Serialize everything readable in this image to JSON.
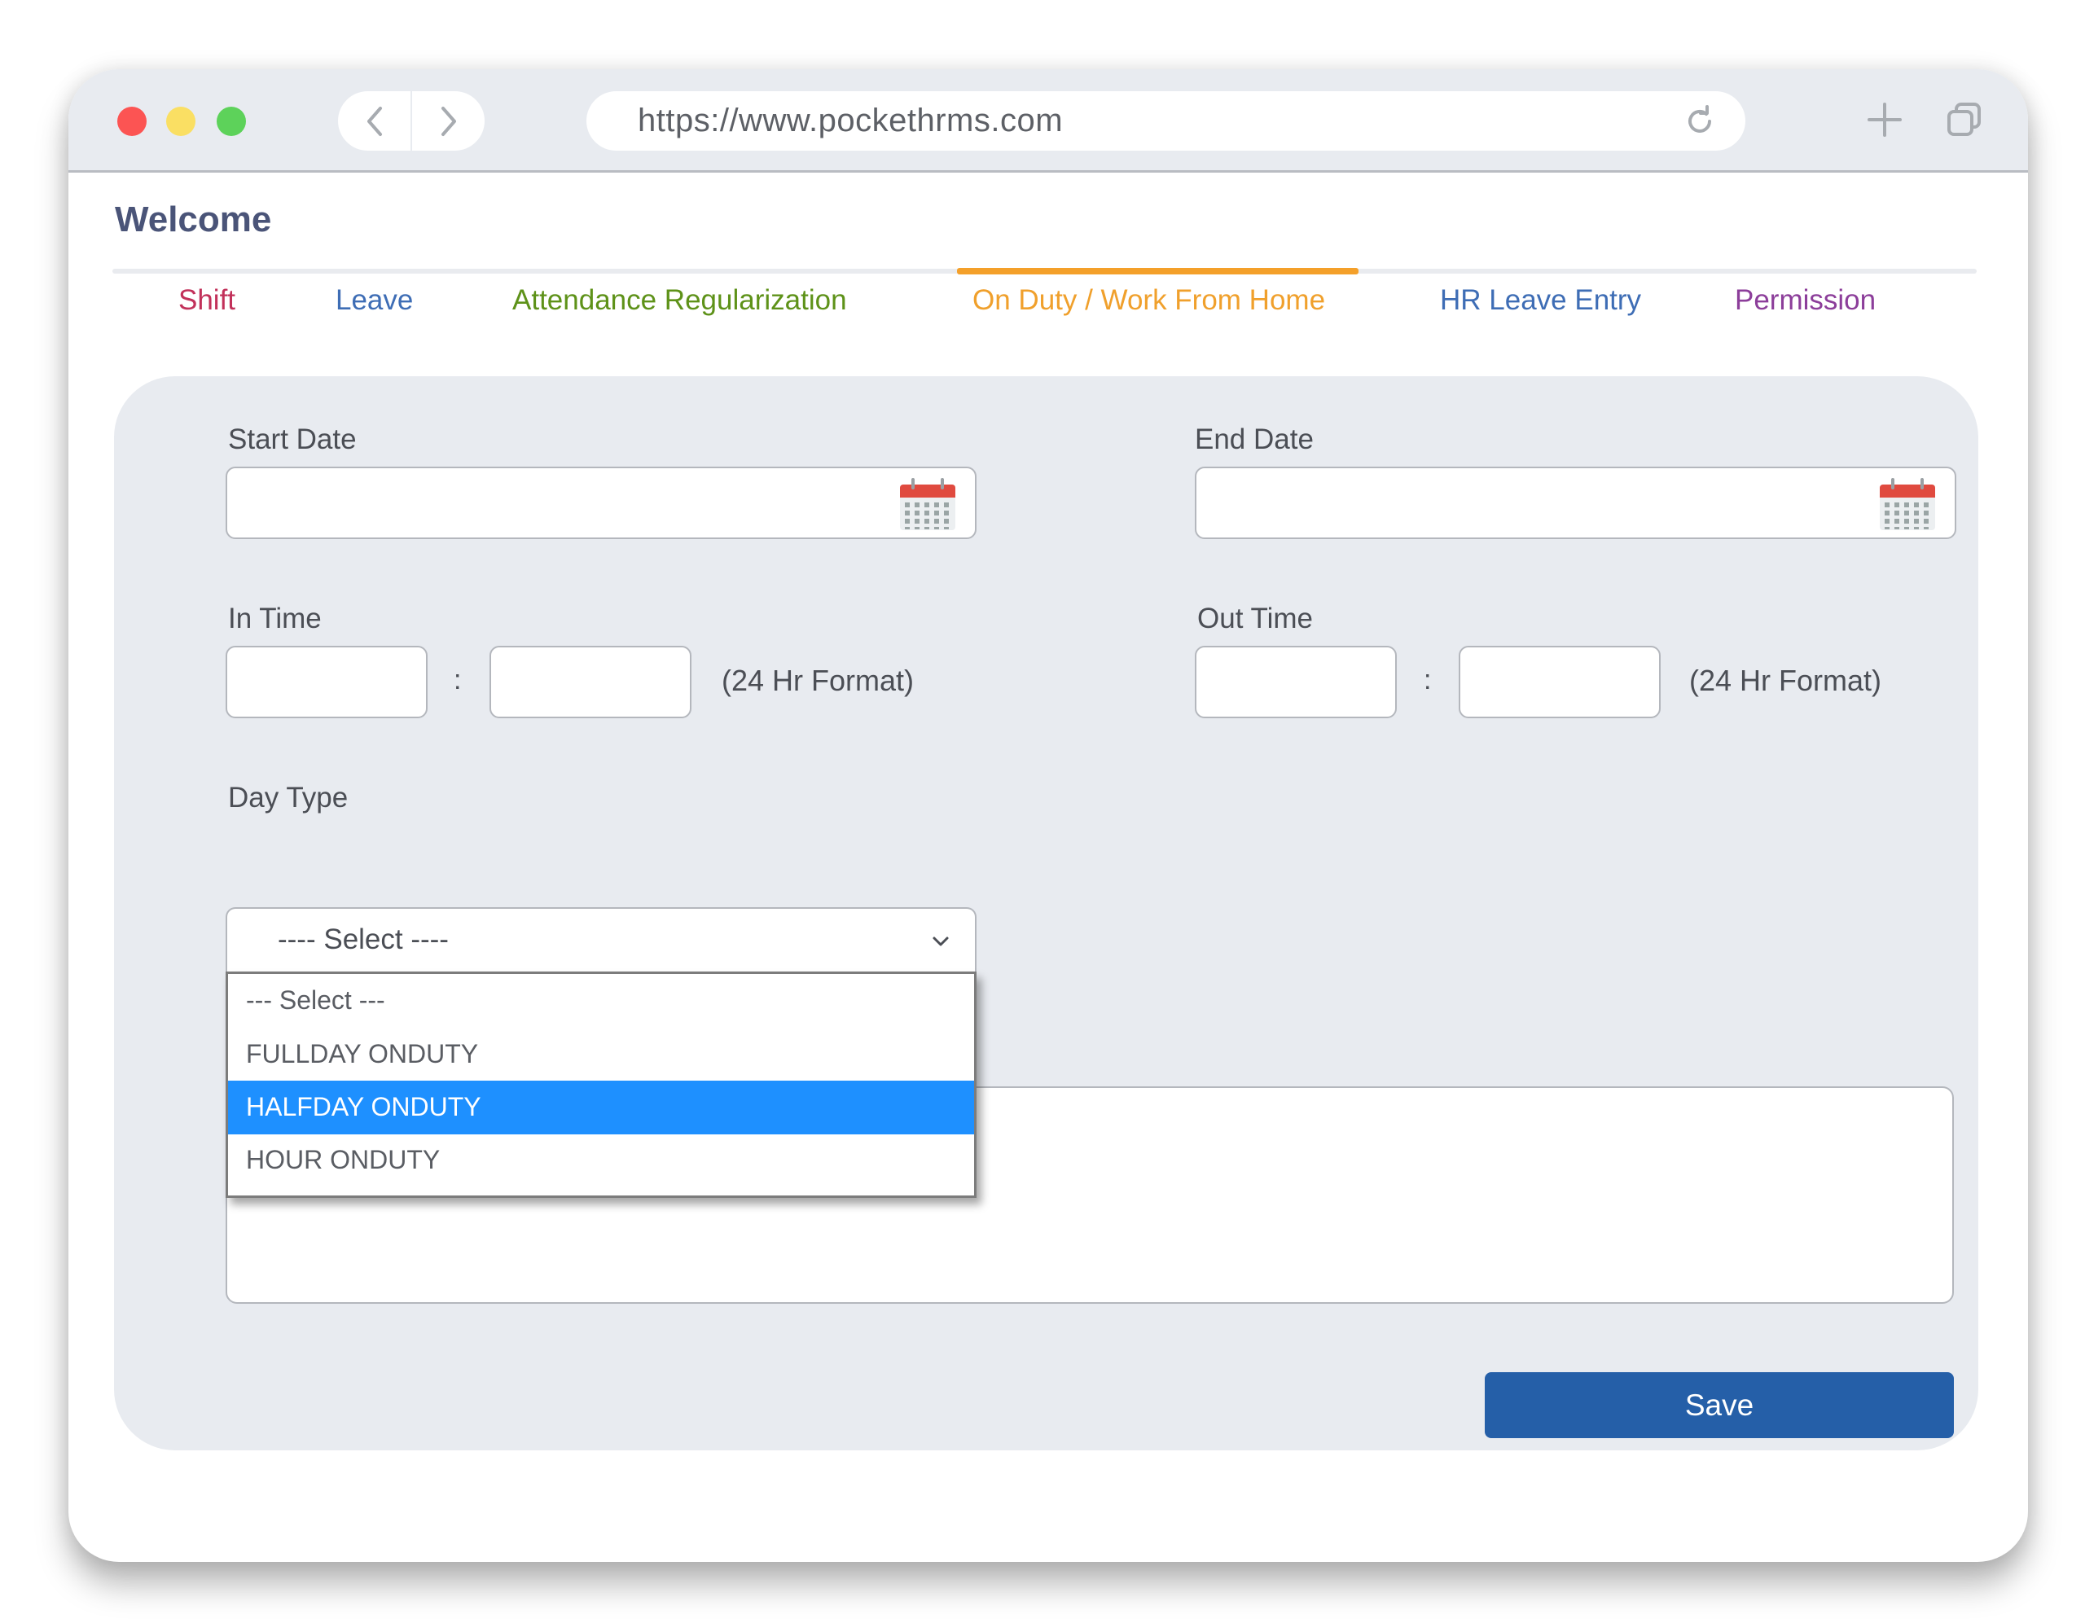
{
  "browser": {
    "url": "https://www.pockethrms.com",
    "icons": {
      "back": "chevron-left-icon",
      "forward": "chevron-right-icon",
      "reload": "reload-icon",
      "new_tab": "plus-icon",
      "tabs": "tabs-overview-icon"
    },
    "traffic_lights": [
      "#fc5453",
      "#fadf63",
      "#5dd25a"
    ]
  },
  "page": {
    "title": "Welcome"
  },
  "tabs": [
    {
      "label": "Shift",
      "color": "#c2315a",
      "active": false
    },
    {
      "label": "Leave",
      "color": "#3e6db5",
      "active": false
    },
    {
      "label": "Attendance Regularization",
      "color": "#5e9219",
      "active": false
    },
    {
      "label": "On Duty / Work From Home",
      "color": "#f0a02c",
      "active": true
    },
    {
      "label": "HR Leave Entry",
      "color": "#3e6db5",
      "active": false
    },
    {
      "label": "Permission",
      "color": "#8c3e9a",
      "active": false
    }
  ],
  "form": {
    "start_date": {
      "label": "Start Date",
      "value": "",
      "icon": "calendar-icon"
    },
    "end_date": {
      "label": "End Date",
      "value": "",
      "icon": "calendar-icon"
    },
    "in_time": {
      "label": "In Time",
      "hours": "",
      "minutes": "",
      "separator": ":",
      "hint": "(24 Hr Format)"
    },
    "out_time": {
      "label": "Out Time",
      "hours": "",
      "minutes": "",
      "separator": ":",
      "hint": "(24 Hr Format)"
    },
    "day_type": {
      "label": "Day Type",
      "selected": "---- Select ----",
      "options": [
        "--- Select ---",
        "FULLDAY ONDUTY",
        "HALFDAY ONDUTY",
        "HOUR ONDUTY"
      ],
      "highlighted_index": 2
    },
    "remarks": {
      "value": ""
    },
    "save_label": "Save"
  },
  "colors": {
    "accent_active_tab": "#f4a02a",
    "save_button": "#255fa8",
    "highlight_option": "#1e90ff",
    "calendar_header": "#e04a3f"
  }
}
